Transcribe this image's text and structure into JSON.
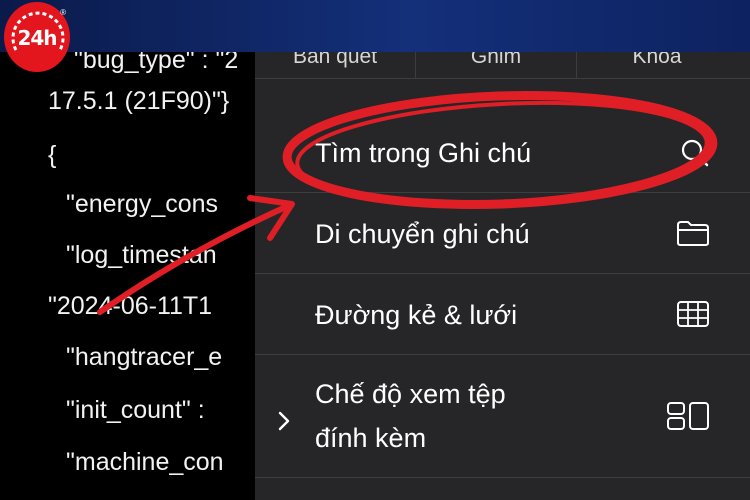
{
  "logo": {
    "text": "24h",
    "mark": "®"
  },
  "code_lines": [
    "\"bug_type\" : \"2",
    "17.5.1 (21F90)\"}",
    "{",
    "\"energy_cons",
    "\"log_timestan",
    "\"2024-06-11T1",
    "\"hangtracer_e",
    "\"init_count\" :",
    "\"machine_con"
  ],
  "menu": {
    "tabs": [
      "Bản quét",
      "Ghim",
      "Khóa"
    ],
    "items": [
      {
        "label": "Tìm trong Ghi chú",
        "icon": "search-icon"
      },
      {
        "label": "Di chuyển ghi chú",
        "icon": "folder-icon"
      },
      {
        "label": "Đường kẻ & lưới",
        "icon": "grid-icon"
      },
      {
        "label_line1": "Chế độ xem tệp",
        "label_line2": "đính kèm",
        "icon": "attachment-view-icon"
      }
    ]
  },
  "colors": {
    "menu_bg": "#262628",
    "annotation_red": "#e01e26",
    "header_blue": "#14307a"
  }
}
